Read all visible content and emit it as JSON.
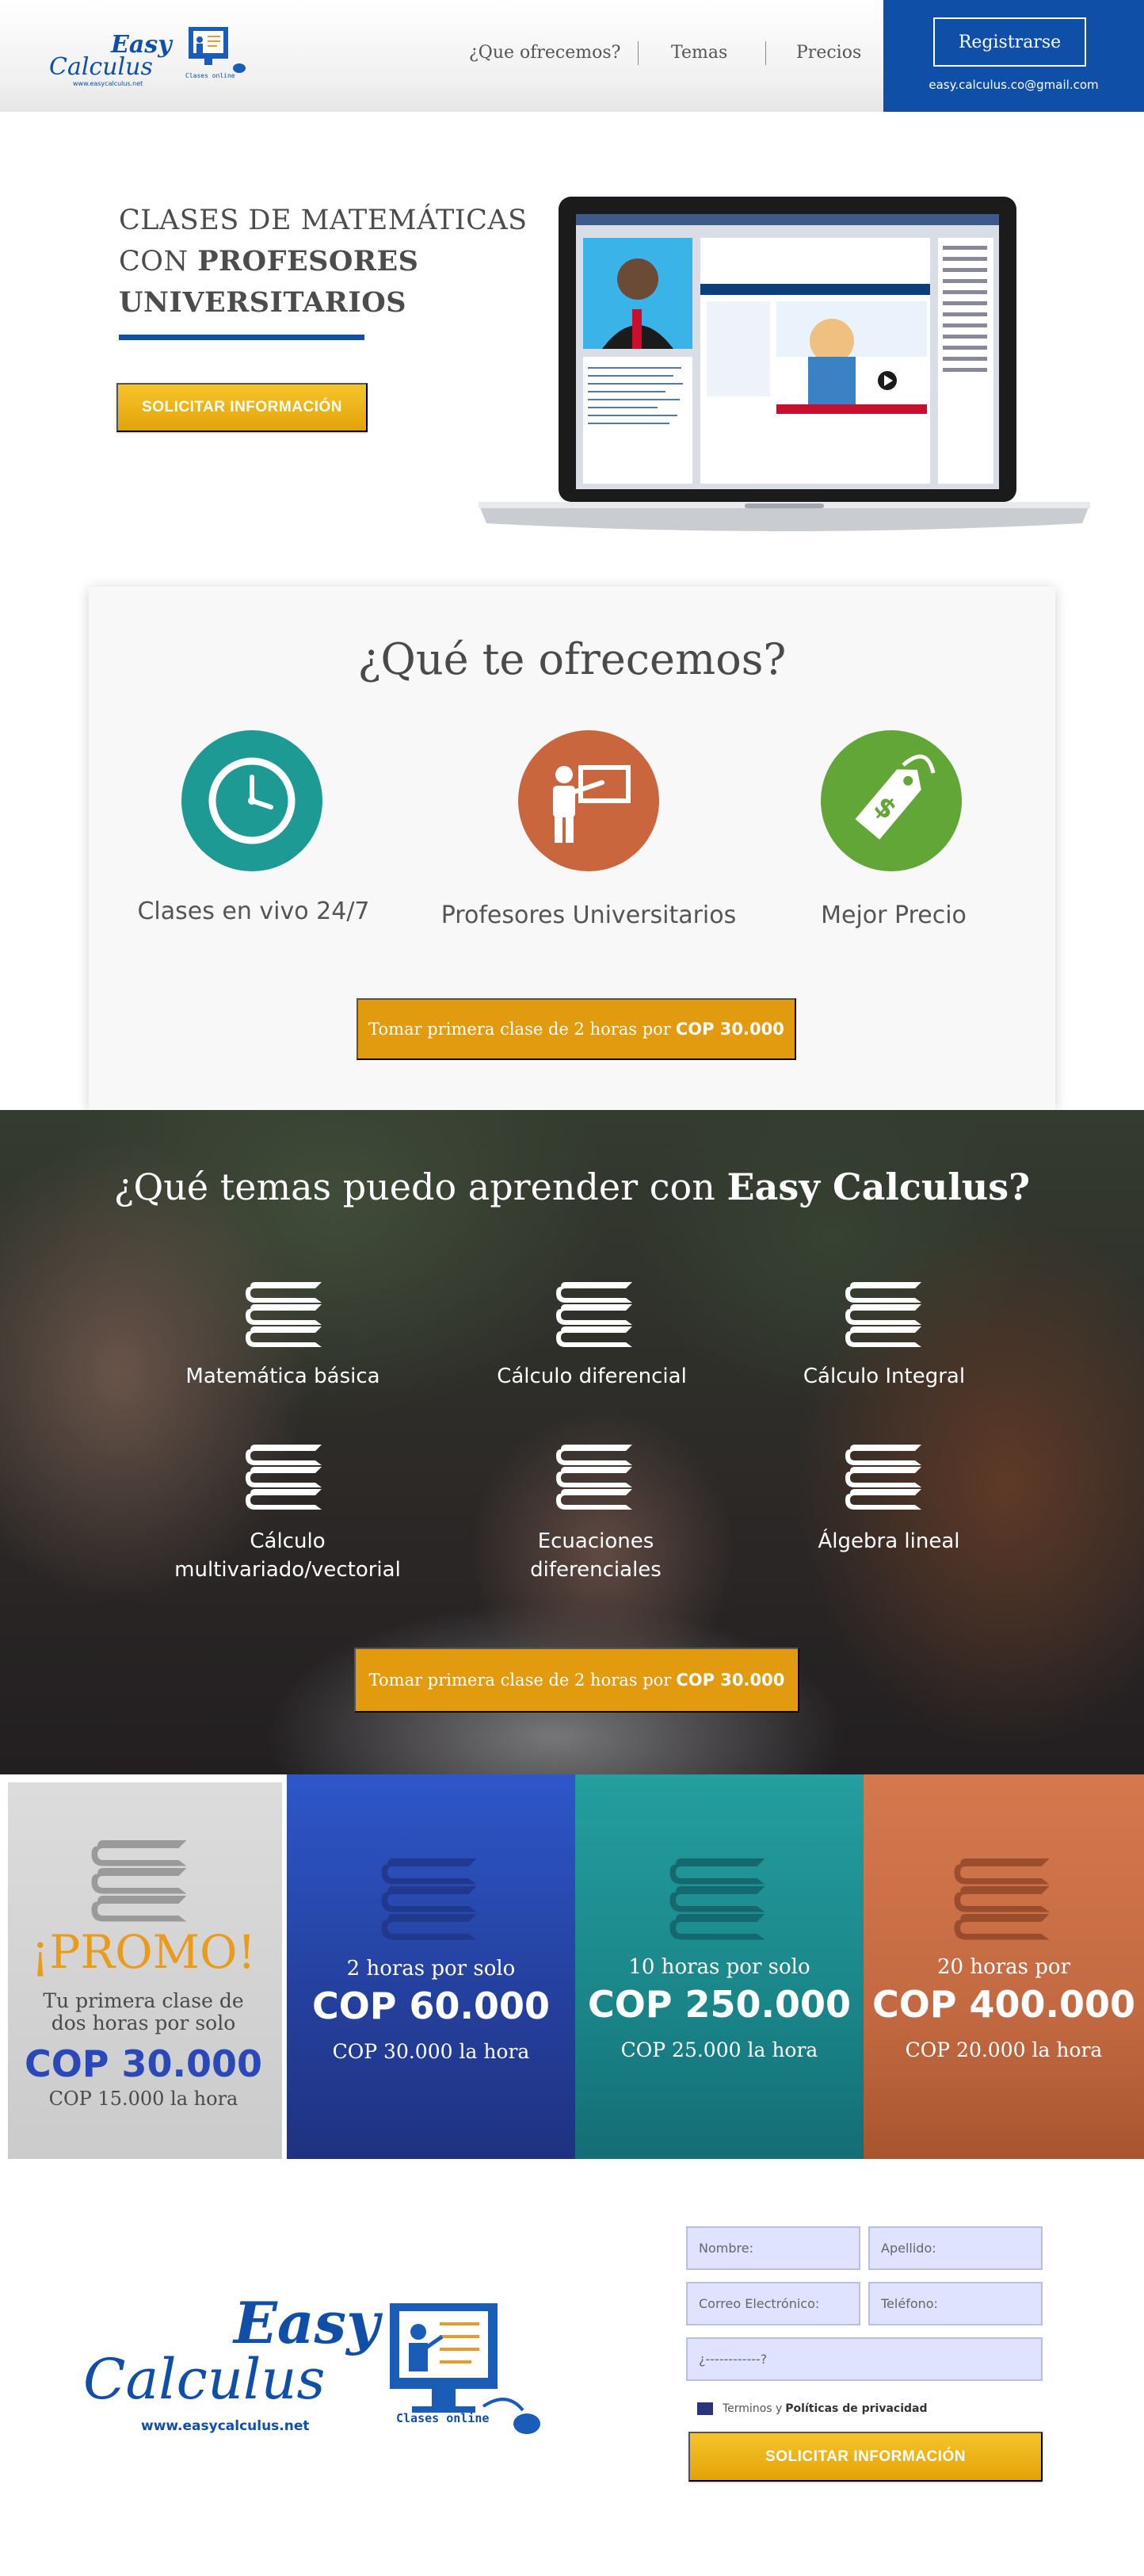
{
  "header": {
    "logo_top": "Easy",
    "logo_bottom": "Calculus",
    "logo_url": "www.easycalculus.net",
    "logo_tag": "Clases online",
    "nav": [
      "¿Que ofrecemos?",
      "Temas",
      "Precios"
    ],
    "register_label": "Registrarse",
    "email": "easy.calculus.co@gmail.com",
    "brand_color": "#0f4fa8"
  },
  "hero": {
    "title_line1": "CLASES DE MATEMÁTICAS",
    "title_line2_prefix": "CON ",
    "title_line2_bold": "PROFESORES",
    "title_line3_bold": "UNIVERSITARIOS",
    "cta_label": "SOLICITAR INFORMACIÓN"
  },
  "offer": {
    "title": "¿Qué te ofrecemos?",
    "features": [
      {
        "label": "Clases en vivo 24/7",
        "icon": "clock-icon",
        "color": "#1e9a94"
      },
      {
        "label": "Profesores Universitarios",
        "icon": "teacher-icon",
        "color": "#c9663d"
      },
      {
        "label": "Mejor Precio",
        "icon": "price-tag-icon",
        "color": "#62a638"
      }
    ],
    "cta_text": "Tomar primera clase de  2 horas por",
    "cta_price": "COP 30.000"
  },
  "topics": {
    "title_prefix": "¿Qué temas puedo aprender con ",
    "title_bold": "Easy Calculus?",
    "items": [
      {
        "label": "Matemática básica",
        "icon": "books-icon"
      },
      {
        "label": "Cálculo diferencial",
        "icon": "books-icon"
      },
      {
        "label": "Cálculo Integral",
        "icon": "books-icon"
      },
      {
        "label": "Cálculo multivariado/vectorial",
        "icon": "books-icon"
      },
      {
        "label": "Ecuaciones diferenciales",
        "icon": "books-icon"
      },
      {
        "label": "Álgebra lineal",
        "icon": "books-icon"
      }
    ],
    "cta_text": "Tomar primera clase de  2 horas por",
    "cta_price": "COP 30.000"
  },
  "pricing": {
    "promo": {
      "title": "¡PROMO!",
      "line1": "Tu primera clase de",
      "line2": "dos horas por solo",
      "price": "COP 30.000",
      "per_hour": "COP 15.000 la hora"
    },
    "plans": [
      {
        "line": "2 horas por solo",
        "price": "COP 60.000",
        "per_hour": "COP 30.000 la hora",
        "color": "#2b48b8"
      },
      {
        "line": "10 horas por solo",
        "price": "COP 250.000",
        "per_hour": "COP 25.000 la hora",
        "color": "#1f8f94"
      },
      {
        "line": "20 horas por",
        "price": "COP 400.000",
        "per_hour": "COP 20.000 la hora",
        "color": "#c46a42"
      }
    ]
  },
  "form": {
    "name_placeholder": "Nombre:",
    "lastname_placeholder": "Apellido:",
    "email_placeholder": "Correo Electrónico:",
    "phone_placeholder": "Teléfono:",
    "question_placeholder": "¿------------?",
    "terms_text": "Terminos y",
    "terms_link": "Políticas de privacidad",
    "submit_label": "SOLICITAR INFORMACIÓN"
  }
}
